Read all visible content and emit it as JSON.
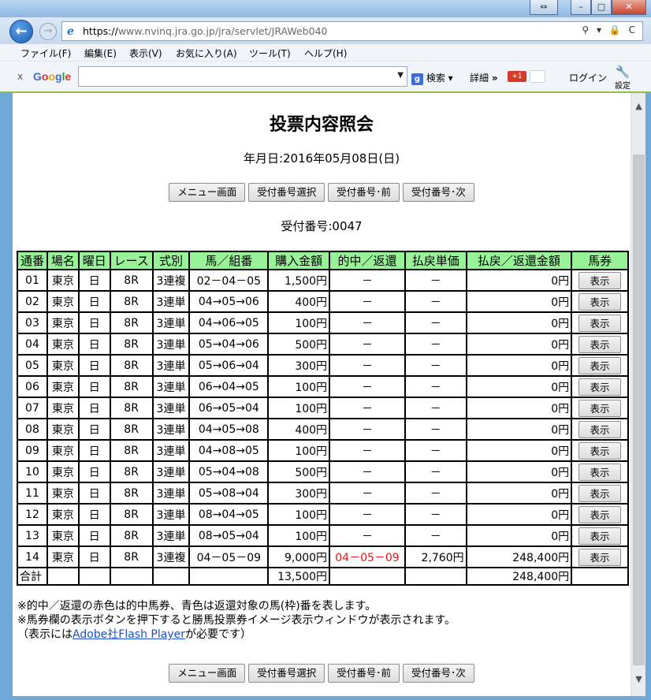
{
  "browser": {
    "url_prefix": "https://",
    "url_host": "www.nvinq.jra.go.jp",
    "url_path": "/jra/servlet/JRAWeb040",
    "address_icons": "⚲ ▾ 🔒 C",
    "menu": [
      "ファイル(F)",
      "編集(E)",
      "表示(V)",
      "お気に入り(A)",
      "ツール(T)",
      "ヘルプ(H)"
    ],
    "google_bar": {
      "logo": [
        "G",
        "o",
        "o",
        "g",
        "l",
        "e"
      ],
      "search_label": "検索",
      "detail_label": "詳細",
      "plus_label": "+1",
      "login_label": "ログイン",
      "settings_label": "設定"
    }
  },
  "page": {
    "title": "投票内容照会",
    "date_line": "年月日:2016年05月08日(日)",
    "receipt_line": "受付番号:0047",
    "buttons": [
      "メニュー画面",
      "受付番号選択",
      "受付番号･前",
      "受付番号･次"
    ]
  },
  "table": {
    "headers": [
      "通番",
      "場名",
      "曜日",
      "レース",
      "式別",
      "馬／組番",
      "購入金額",
      "的中／返還",
      "払戻単価",
      "払戻／返還金額",
      "馬券"
    ],
    "show_label": "表示",
    "rows": [
      {
        "no": "01",
        "place": "東京",
        "day": "日",
        "race": "8R",
        "type": "3連複",
        "combo": "02－04－05",
        "amount": "1,500円",
        "hit": "－",
        "unit": "－",
        "payout": "0円",
        "hit_red": false
      },
      {
        "no": "02",
        "place": "東京",
        "day": "日",
        "race": "8R",
        "type": "3連単",
        "combo": "04→05→06",
        "amount": "400円",
        "hit": "－",
        "unit": "－",
        "payout": "0円",
        "hit_red": false
      },
      {
        "no": "03",
        "place": "東京",
        "day": "日",
        "race": "8R",
        "type": "3連単",
        "combo": "04→06→05",
        "amount": "100円",
        "hit": "－",
        "unit": "－",
        "payout": "0円",
        "hit_red": false
      },
      {
        "no": "04",
        "place": "東京",
        "day": "日",
        "race": "8R",
        "type": "3連単",
        "combo": "05→04→06",
        "amount": "500円",
        "hit": "－",
        "unit": "－",
        "payout": "0円",
        "hit_red": false
      },
      {
        "no": "05",
        "place": "東京",
        "day": "日",
        "race": "8R",
        "type": "3連単",
        "combo": "05→06→04",
        "amount": "300円",
        "hit": "－",
        "unit": "－",
        "payout": "0円",
        "hit_red": false
      },
      {
        "no": "06",
        "place": "東京",
        "day": "日",
        "race": "8R",
        "type": "3連単",
        "combo": "06→04→05",
        "amount": "100円",
        "hit": "－",
        "unit": "－",
        "payout": "0円",
        "hit_red": false
      },
      {
        "no": "07",
        "place": "東京",
        "day": "日",
        "race": "8R",
        "type": "3連単",
        "combo": "06→05→04",
        "amount": "100円",
        "hit": "－",
        "unit": "－",
        "payout": "0円",
        "hit_red": false
      },
      {
        "no": "08",
        "place": "東京",
        "day": "日",
        "race": "8R",
        "type": "3連単",
        "combo": "04→05→08",
        "amount": "400円",
        "hit": "－",
        "unit": "－",
        "payout": "0円",
        "hit_red": false
      },
      {
        "no": "09",
        "place": "東京",
        "day": "日",
        "race": "8R",
        "type": "3連単",
        "combo": "04→08→05",
        "amount": "100円",
        "hit": "－",
        "unit": "－",
        "payout": "0円",
        "hit_red": false
      },
      {
        "no": "10",
        "place": "東京",
        "day": "日",
        "race": "8R",
        "type": "3連単",
        "combo": "05→04→08",
        "amount": "500円",
        "hit": "－",
        "unit": "－",
        "payout": "0円",
        "hit_red": false
      },
      {
        "no": "11",
        "place": "東京",
        "day": "日",
        "race": "8R",
        "type": "3連単",
        "combo": "05→08→04",
        "amount": "300円",
        "hit": "－",
        "unit": "－",
        "payout": "0円",
        "hit_red": false
      },
      {
        "no": "12",
        "place": "東京",
        "day": "日",
        "race": "8R",
        "type": "3連単",
        "combo": "08→04→05",
        "amount": "100円",
        "hit": "－",
        "unit": "－",
        "payout": "0円",
        "hit_red": false
      },
      {
        "no": "13",
        "place": "東京",
        "day": "日",
        "race": "8R",
        "type": "3連単",
        "combo": "08→05→04",
        "amount": "100円",
        "hit": "－",
        "unit": "－",
        "payout": "0円",
        "hit_red": false
      },
      {
        "no": "14",
        "place": "東京",
        "day": "日",
        "race": "8R",
        "type": "3連複",
        "combo": "04－05－09",
        "amount": "9,000円",
        "hit": "04－05－09",
        "unit": "2,760円",
        "payout": "248,400円",
        "hit_red": true
      }
    ],
    "total": {
      "label": "合計",
      "amount": "13,500円",
      "payout": "248,400円"
    }
  },
  "notes": {
    "line1": "※的中／返還の赤色は的中馬券、青色は返還対象の馬(枠)番を表します。",
    "line2": "※馬券欄の表示ボタンを押下すると勝馬投票券イメージ表示ウィンドウが表示されます。",
    "line3_pre": "（表示には",
    "line3_link": "Adobe社Flash Player",
    "line3_post": "が必要です）"
  },
  "colors": {
    "header_bg": "#98f298",
    "hit_red": "#e21818",
    "link_blue": "#1a4fc8"
  }
}
